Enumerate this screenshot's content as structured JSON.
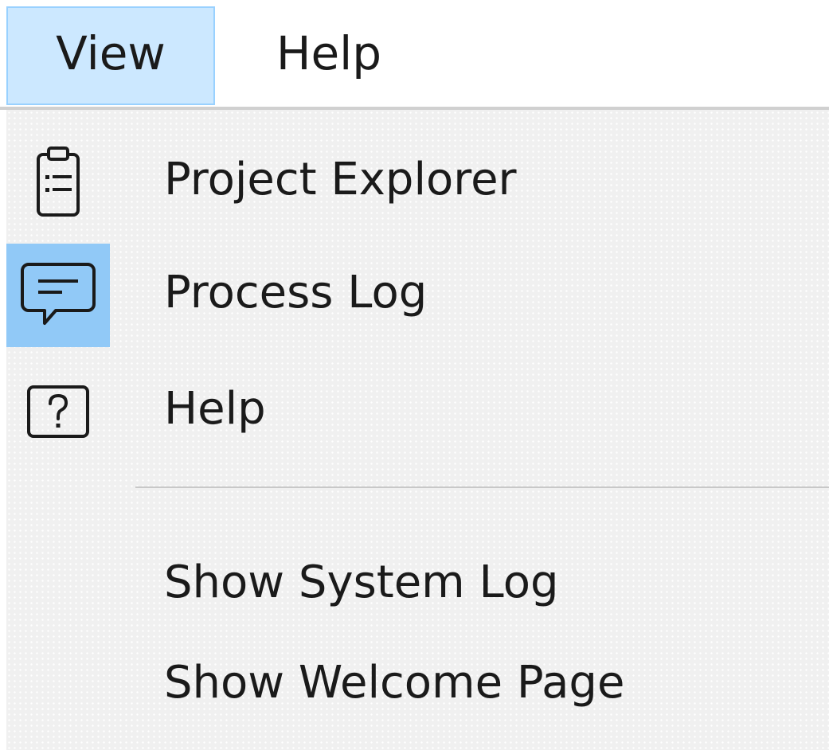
{
  "menubar": {
    "items": [
      {
        "label": "View",
        "active": true
      },
      {
        "label": "Help",
        "active": false
      }
    ]
  },
  "view_menu": {
    "items": [
      {
        "label": "Project Explorer",
        "icon": "clipboard-list-icon",
        "checked": false
      },
      {
        "label": "Process Log",
        "icon": "chat-bubble-icon",
        "checked": true
      },
      {
        "label": "Help",
        "icon": "question-box-icon",
        "checked": false
      }
    ],
    "extra_items": [
      {
        "label": "Show System Log"
      },
      {
        "label": "Show Welcome Page"
      }
    ]
  },
  "colors": {
    "active_menubar_bg": "#cce8ff",
    "checked_icon_bg": "#91c9f7",
    "menu_bg": "#f0f0f0"
  }
}
